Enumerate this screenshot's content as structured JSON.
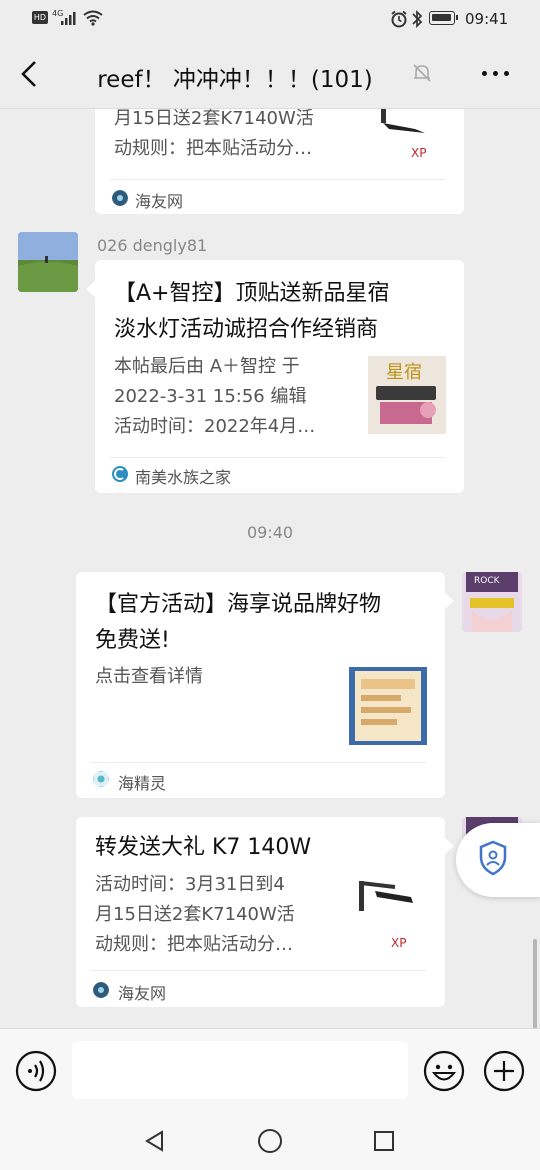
{
  "status_bar": {
    "left_badge": "HD",
    "network": "4G",
    "time": "09:41"
  },
  "header": {
    "title": "reef！ 冲冲冲！！！(101)",
    "back_icon": "chevron-left-icon",
    "mute_icon": "bell-off-icon",
    "more_icon": "more-icon"
  },
  "messages": [
    {
      "kind": "link-card",
      "sender": "other-partial",
      "desc": [
        "月15日送2套K7140W活",
        "动规则：把本贴活动分…"
      ],
      "source": "海友网"
    },
    {
      "kind": "link-card",
      "sender_name": "026 dengly81",
      "title": [
        "【A+智控】顶贴送新品星宿",
        "淡水灯活动诚招合作经销商"
      ],
      "desc": [
        " 本帖最后由 A＋智控 于",
        "2022-3-31 15:56 编辑",
        "活动时间：2022年4月…"
      ],
      "source": "南美水族之家",
      "thumb_label": "星宿"
    },
    {
      "kind": "timestamp",
      "text": "09:40"
    },
    {
      "kind": "link-card",
      "sender": "self",
      "title": [
        "【官方活动】海享说品牌好物",
        "免费送!"
      ],
      "desc": [
        "点击查看详情"
      ],
      "source": "海精灵"
    },
    {
      "kind": "link-card",
      "sender": "self",
      "title": [
        "转发送大礼 K7 140W"
      ],
      "desc": [
        "活动时间：3月31日到4",
        "月15日送2套K7140W活",
        "动规则：把本贴活动分…"
      ],
      "source": "海友网"
    }
  ],
  "self_avatar_text": "ROCK",
  "inputbar": {
    "voice_icon": "voice-icon",
    "emoji_icon": "emoji-icon",
    "plus_icon": "plus-icon",
    "text_value": ""
  },
  "colors": {
    "background": "#ededed",
    "bubble": "#ffffff",
    "title": "#111111",
    "desc": "#555555",
    "float_button_accent": "#3f76c9"
  }
}
